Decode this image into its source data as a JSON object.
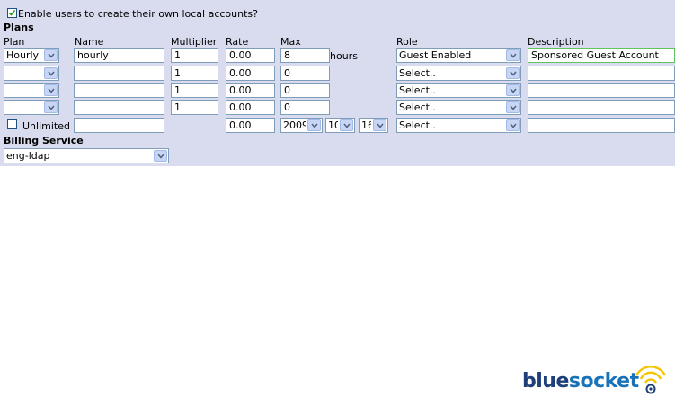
{
  "enable_local_accounts": {
    "label": "Enable users to create their own local accounts?",
    "checked": true
  },
  "plans": {
    "title": "Plans",
    "columns": {
      "plan": "Plan",
      "name": "Name",
      "multiplier": "Multiplier",
      "rate": "Rate",
      "max": "Max",
      "role": "Role",
      "description": "Description"
    },
    "hours_label": "hours",
    "rows": [
      {
        "plan": "Hourly",
        "name": "hourly",
        "multiplier": "1",
        "rate": "0.00",
        "max": "8",
        "role": "Guest Enabled",
        "description": "Sponsored Guest Account"
      },
      {
        "plan": "",
        "name": "",
        "multiplier": "1",
        "rate": "0.00",
        "max": "0",
        "role": "Select..",
        "description": ""
      },
      {
        "plan": "",
        "name": "",
        "multiplier": "1",
        "rate": "0.00",
        "max": "0",
        "role": "Select..",
        "description": ""
      },
      {
        "plan": "",
        "name": "",
        "multiplier": "1",
        "rate": "0.00",
        "max": "0",
        "role": "Select..",
        "description": ""
      }
    ],
    "unlimited_row": {
      "label": "Unlimited",
      "checked": false,
      "name": "",
      "rate": "0.00",
      "year": "2009",
      "month": "10",
      "day": "16",
      "role": "Select..",
      "description": ""
    }
  },
  "billing_service": {
    "label": "Billing Service",
    "value": "eng-ldap"
  },
  "logo": {
    "part1": "blue",
    "part2": "socket",
    "colors": {
      "blue": "#1e3f78",
      "socket": "#1a73b8",
      "waves": "#f5c400"
    }
  }
}
